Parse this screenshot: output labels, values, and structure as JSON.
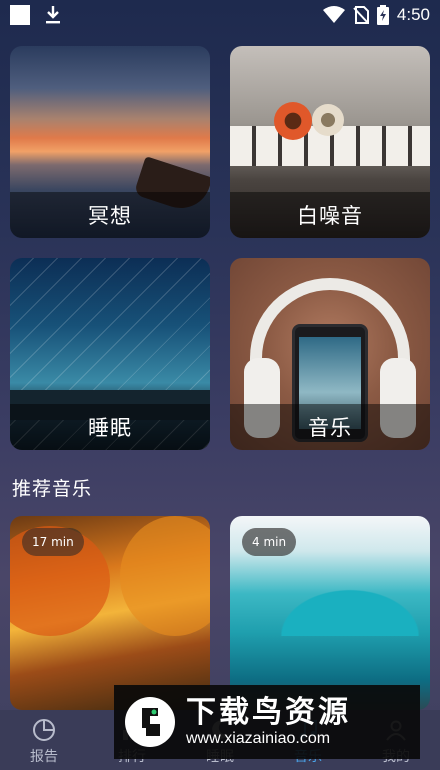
{
  "status_bar": {
    "time": "4:50",
    "icons": [
      "white-square-icon",
      "download-icon",
      "wifi-icon",
      "no-sim-icon",
      "battery-charging-icon"
    ]
  },
  "categories": [
    {
      "label": "冥想",
      "image": "sunset-lake-boat"
    },
    {
      "label": "白噪音",
      "image": "flowers-on-piano"
    },
    {
      "label": "睡眠",
      "image": "star-trails-night-lake"
    },
    {
      "label": "音乐",
      "image": "headphones-and-phone"
    }
  ],
  "recommended": {
    "title": "推荐音乐",
    "items": [
      {
        "duration": "17 min",
        "image": "autumn-forest-path"
      },
      {
        "duration": "4 min",
        "image": "ocean-wave"
      }
    ]
  },
  "bottom_nav": {
    "items": [
      {
        "label": "报告",
        "icon": "pie-chart-icon",
        "active": false
      },
      {
        "label": "排行",
        "icon": "ranking-icon",
        "active": false
      },
      {
        "label": "睡眠",
        "icon": "moon-icon",
        "active": false
      },
      {
        "label": "音乐",
        "icon": "music-icon",
        "active": true
      },
      {
        "label": "我的",
        "icon": "user-icon",
        "active": false
      }
    ],
    "active_color": "#4aa3e8"
  },
  "watermark": {
    "title": "下载鸟资源",
    "url": "www.xiazainiao.com"
  }
}
